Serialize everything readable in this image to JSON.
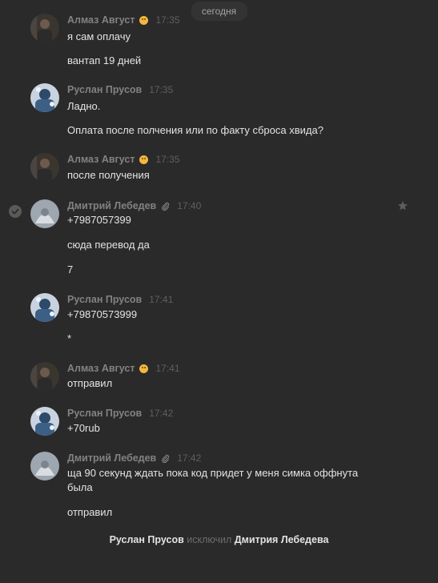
{
  "date_divider": "сегодня",
  "messages": [
    {
      "author": "Алмаз Август",
      "time": "17:35",
      "lines": [
        "я сам оплачу",
        "вантап 19 дней"
      ]
    },
    {
      "author": "Руслан Прусов",
      "time": "17:35",
      "lines": [
        "Ладно.",
        "Оплата после полчения или по факту сброса хвида?"
      ]
    },
    {
      "author": "Алмаз Август",
      "time": "17:35",
      "lines": [
        "после получения"
      ]
    },
    {
      "author": "Дмитрий Лебедев",
      "time": "17:40",
      "lines": [
        "+7987057399",
        "сюда перевод да",
        "7"
      ]
    },
    {
      "author": "Руслан Прусов",
      "time": "17:41",
      "lines": [
        "+79870573999",
        "*"
      ]
    },
    {
      "author": "Алмаз Август",
      "time": "17:41",
      "lines": [
        "отправил"
      ]
    },
    {
      "author": "Руслан Прусов",
      "time": "17:42",
      "lines": [
        "+70rub"
      ]
    },
    {
      "author": "Дмитрий Лебедев",
      "time": "17:42",
      "lines": [
        "ща 90 секунд ждать пока код придет у меня симка оффнута была",
        "отправил"
      ]
    }
  ],
  "service_message": {
    "actor": "Руслан Прусов",
    "action": "исключил",
    "target": "Дмитрия Лебедева"
  },
  "colors": {
    "background": "#2a2a2a",
    "author": "#828282",
    "time": "#5f5f5f",
    "text": "#e1e3e6"
  },
  "icons": {
    "status_emoji": "smiley-emoji-icon",
    "attachment": "paperclip-icon",
    "selected": "check-circle-icon",
    "favorite": "star-icon"
  }
}
